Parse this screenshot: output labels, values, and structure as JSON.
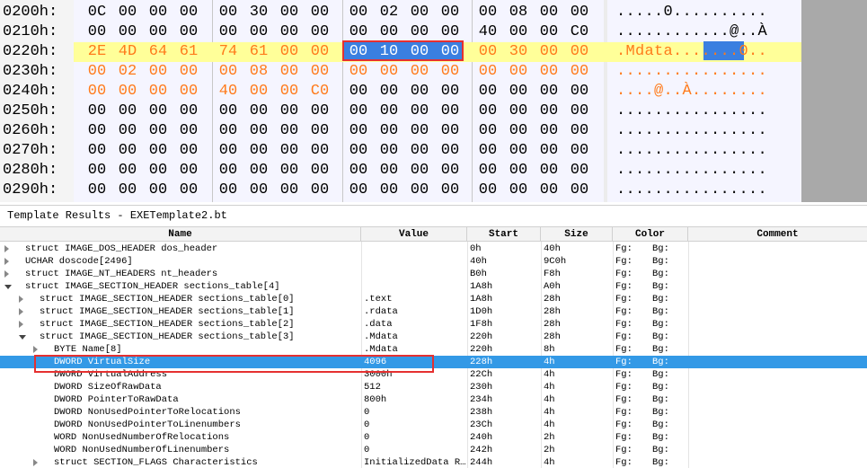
{
  "hex_view": {
    "rows": [
      {
        "address": "0200h:",
        "bytes": [
          "0C",
          "00",
          "00",
          "00",
          "00",
          "30",
          "00",
          "00",
          "00",
          "02",
          "00",
          "00",
          "00",
          "08",
          "00",
          "00"
        ],
        "ascii": ".....0.........."
      },
      {
        "address": "0210h:",
        "bytes": [
          "00",
          "00",
          "00",
          "00",
          "00",
          "00",
          "00",
          "00",
          "00",
          "00",
          "00",
          "00",
          "40",
          "00",
          "00",
          "C0"
        ],
        "ascii": "............@..À"
      },
      {
        "address": "0220h:",
        "bytes": [
          "2E",
          "4D",
          "64",
          "61",
          "74",
          "61",
          "00",
          "00",
          "00",
          "10",
          "00",
          "00",
          "00",
          "30",
          "00",
          "00"
        ],
        "ascii": ".Mdata.......0.."
      },
      {
        "address": "0230h:",
        "bytes": [
          "00",
          "02",
          "00",
          "00",
          "00",
          "08",
          "00",
          "00",
          "00",
          "00",
          "00",
          "00",
          "00",
          "00",
          "00",
          "00"
        ],
        "ascii": "................"
      },
      {
        "address": "0240h:",
        "bytes": [
          "00",
          "00",
          "00",
          "00",
          "40",
          "00",
          "00",
          "C0",
          "00",
          "00",
          "00",
          "00",
          "00",
          "00",
          "00",
          "00"
        ],
        "ascii": "....@..À........"
      },
      {
        "address": "0250h:",
        "bytes": [
          "00",
          "00",
          "00",
          "00",
          "00",
          "00",
          "00",
          "00",
          "00",
          "00",
          "00",
          "00",
          "00",
          "00",
          "00",
          "00"
        ],
        "ascii": "................"
      },
      {
        "address": "0260h:",
        "bytes": [
          "00",
          "00",
          "00",
          "00",
          "00",
          "00",
          "00",
          "00",
          "00",
          "00",
          "00",
          "00",
          "00",
          "00",
          "00",
          "00"
        ],
        "ascii": "................"
      },
      {
        "address": "0270h:",
        "bytes": [
          "00",
          "00",
          "00",
          "00",
          "00",
          "00",
          "00",
          "00",
          "00",
          "00",
          "00",
          "00",
          "00",
          "00",
          "00",
          "00"
        ],
        "ascii": "................"
      },
      {
        "address": "0280h:",
        "bytes": [
          "00",
          "00",
          "00",
          "00",
          "00",
          "00",
          "00",
          "00",
          "00",
          "00",
          "00",
          "00",
          "00",
          "00",
          "00",
          "00"
        ],
        "ascii": "................"
      },
      {
        "address": "0290h:",
        "bytes": [
          "00",
          "00",
          "00",
          "00",
          "00",
          "00",
          "00",
          "00",
          "00",
          "00",
          "00",
          "00",
          "00",
          "00",
          "00",
          "00"
        ],
        "ascii": "................"
      }
    ],
    "colors": {
      "normal_text": "#000000",
      "struct_text": "#ff7a1a",
      "highlight_row_bg": "#ffff99",
      "selection_bg": "#3a7fe0",
      "selection_border": "#e53030",
      "pane_bg": "#f5f5ff"
    }
  },
  "template_results": {
    "title": "Template Results - EXETemplate2.bt",
    "columns": [
      "Name",
      "Value",
      "Start",
      "Size",
      "Color",
      "Comment"
    ],
    "rows": [
      {
        "indent": 0,
        "toggle": "right",
        "name": "struct IMAGE_DOS_HEADER dos_header",
        "value": "",
        "start": "0h",
        "size": "40h",
        "fg": "Fg:",
        "bg": "Bg:"
      },
      {
        "indent": 0,
        "toggle": "right",
        "name": "UCHAR doscode[2496]",
        "value": "",
        "start": "40h",
        "size": "9C0h",
        "fg": "Fg:",
        "bg": "Bg:"
      },
      {
        "indent": 0,
        "toggle": "right",
        "name": "struct IMAGE_NT_HEADERS nt_headers",
        "value": "",
        "start": "B0h",
        "size": "F8h",
        "fg": "Fg:",
        "bg": "Bg:"
      },
      {
        "indent": 0,
        "toggle": "down",
        "name": "struct IMAGE_SECTION_HEADER sections_table[4]",
        "value": "",
        "start": "1A8h",
        "size": "A0h",
        "fg": "Fg:",
        "bg": "Bg:"
      },
      {
        "indent": 1,
        "toggle": "right",
        "name": "struct IMAGE_SECTION_HEADER sections_table[0]",
        "value": ".text",
        "start": "1A8h",
        "size": "28h",
        "fg": "Fg:",
        "bg": "Bg:"
      },
      {
        "indent": 1,
        "toggle": "right",
        "name": "struct IMAGE_SECTION_HEADER sections_table[1]",
        "value": ".rdata",
        "start": "1D0h",
        "size": "28h",
        "fg": "Fg:",
        "bg": "Bg:"
      },
      {
        "indent": 1,
        "toggle": "right",
        "name": "struct IMAGE_SECTION_HEADER sections_table[2]",
        "value": ".data",
        "start": "1F8h",
        "size": "28h",
        "fg": "Fg:",
        "bg": "Bg:"
      },
      {
        "indent": 1,
        "toggle": "down",
        "name": "struct IMAGE_SECTION_HEADER sections_table[3]",
        "value": ".Mdata",
        "start": "220h",
        "size": "28h",
        "fg": "Fg:",
        "bg": "Bg:"
      },
      {
        "indent": 2,
        "toggle": "right",
        "name": "BYTE Name[8]",
        "value": ".Mdata",
        "start": "220h",
        "size": "8h",
        "fg": "Fg:",
        "bg": "Bg:"
      },
      {
        "indent": 2,
        "toggle": "",
        "name": "DWORD VirtualSize",
        "value": "4096",
        "start": "228h",
        "size": "4h",
        "fg": "Fg:",
        "bg": "Bg:",
        "selected": true
      },
      {
        "indent": 2,
        "toggle": "",
        "name": "DWORD VirtualAddress",
        "value": "3000h",
        "start": "22Ch",
        "size": "4h",
        "fg": "Fg:",
        "bg": "Bg:"
      },
      {
        "indent": 2,
        "toggle": "",
        "name": "DWORD SizeOfRawData",
        "value": "512",
        "start": "230h",
        "size": "4h",
        "fg": "Fg:",
        "bg": "Bg:"
      },
      {
        "indent": 2,
        "toggle": "",
        "name": "DWORD PointerToRawData",
        "value": "800h",
        "start": "234h",
        "size": "4h",
        "fg": "Fg:",
        "bg": "Bg:"
      },
      {
        "indent": 2,
        "toggle": "",
        "name": "DWORD NonUsedPointerToRelocations",
        "value": "0",
        "start": "238h",
        "size": "4h",
        "fg": "Fg:",
        "bg": "Bg:"
      },
      {
        "indent": 2,
        "toggle": "",
        "name": "DWORD NonUsedPointerToLinenumbers",
        "value": "0",
        "start": "23Ch",
        "size": "4h",
        "fg": "Fg:",
        "bg": "Bg:"
      },
      {
        "indent": 2,
        "toggle": "",
        "name": "WORD NonUsedNumberOfRelocations",
        "value": "0",
        "start": "240h",
        "size": "2h",
        "fg": "Fg:",
        "bg": "Bg:"
      },
      {
        "indent": 2,
        "toggle": "",
        "name": "WORD NonUsedNumberOfLinenumbers",
        "value": "0",
        "start": "242h",
        "size": "2h",
        "fg": "Fg:",
        "bg": "Bg:"
      },
      {
        "indent": 2,
        "toggle": "right",
        "name": "struct SECTION_FLAGS Characteristics",
        "value": "InitializedData R…",
        "start": "244h",
        "size": "4h",
        "fg": "Fg:",
        "bg": "Bg:"
      }
    ]
  }
}
